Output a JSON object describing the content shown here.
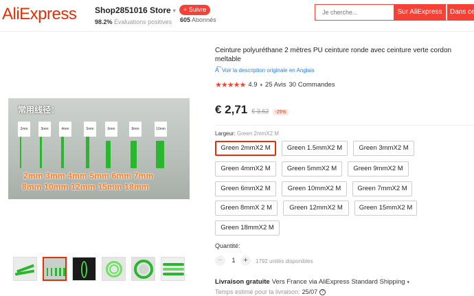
{
  "header": {
    "logo": "AliExpress",
    "store_name": "Shop2851016 Store",
    "store_rating_value": "98.2%",
    "store_rating_label": "Évaluations positives",
    "follow_label": "+ Suivre",
    "subscribers_count": "605",
    "subscribers_label": "Abonnés",
    "search_placeholder": "Je cherche...",
    "search_button": "Sur AliExpress",
    "search_button2": "Dans ce"
  },
  "gallery": {
    "image_heading": "常用线径：",
    "tags": [
      "2mm",
      "3mm",
      "4mm",
      "5mm",
      "6mm",
      "8mm",
      "10mm"
    ],
    "size_line1": "2mm 3mm 4mm 5mm 6mm 7mm",
    "size_line2": "8mm 10mm 12mm 15mm 18mm",
    "thumbnail_count": 6
  },
  "product": {
    "title": "Ceinture polyuréthane 2 mètres PU ceinture ronde avec ceinture verte cordon meltable",
    "translate_label": "Voir la description originale en Anglais",
    "rating": "4.9",
    "reviews": "25 Avis",
    "orders": "30 Commandes",
    "price": "€ 2,71",
    "old_price": "€ 3,62",
    "discount": "-25%",
    "option_label": "Largeur:",
    "option_selected": "Green 2mmX2 M",
    "options": [
      "Green 2mmX2 M",
      "Green 1.5mmX2 M",
      "Green 3mmX2 M",
      "Green 4mmX2 M",
      "Green 5mmX2 M",
      "Green 9mmX2 M",
      "Green 6mmX2 M",
      "Green 10mmX2 M",
      "Green 7mmX2 M",
      "Green 8mmX 2 M",
      "Green 12mmX2 M",
      "Green 15mmX2 M",
      "Green 18mmX2 M"
    ],
    "quantity_label": "Quantité:",
    "quantity": "1",
    "available": "1792 unités disponibles",
    "shipping_free": "Livraison gratuite",
    "shipping_detail": "Vers France via AliExpress Standard Shipping",
    "eta_label": "Temps estimé pour la livraison:",
    "eta_date": "25/07"
  },
  "colors": {
    "brand": "#e62e04",
    "accent": "#f44336",
    "belt_green": "#2bb62f",
    "link": "#2e7bd8"
  }
}
